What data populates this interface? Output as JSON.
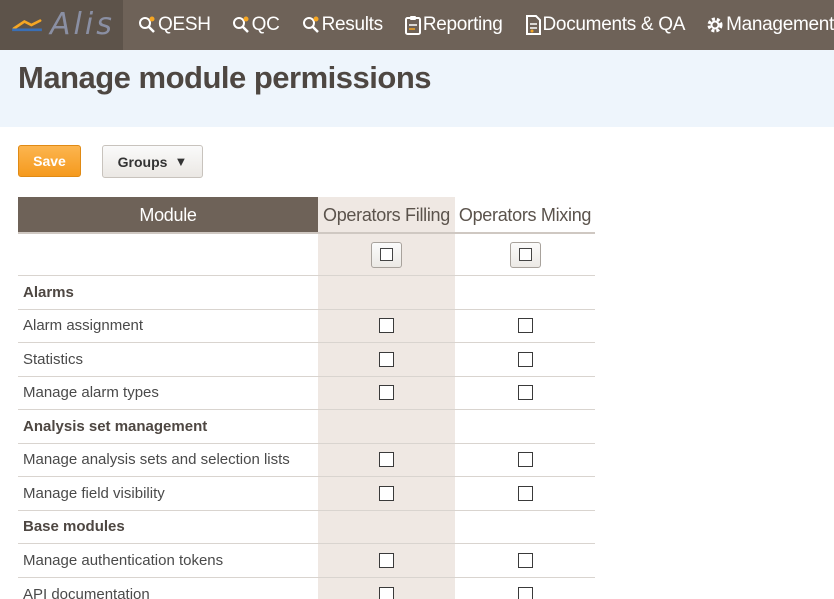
{
  "app": {
    "logo_text": "Alis",
    "nav": [
      {
        "label": "QESH",
        "icon": "search-gear-icon"
      },
      {
        "label": "QC",
        "icon": "search-gear-icon"
      },
      {
        "label": "Results",
        "icon": "search-gear-icon"
      },
      {
        "label": "Reporting",
        "icon": "clipboard-icon"
      },
      {
        "label": "Documents & QA",
        "icon": "document-icon"
      },
      {
        "label": "Management",
        "icon": "gear-icon"
      }
    ]
  },
  "page": {
    "title": "Manage module permissions"
  },
  "toolbar": {
    "save_label": "Save",
    "groups_label": "Groups",
    "groups_caret": "▼"
  },
  "table": {
    "module_header": "Module",
    "groups": [
      "Operators Filling",
      "Operators Mixing"
    ],
    "rows": [
      {
        "type": "section",
        "label": "Alarms"
      },
      {
        "type": "item",
        "label": "Alarm assignment"
      },
      {
        "type": "item",
        "label": "Statistics"
      },
      {
        "type": "item",
        "label": "Manage alarm types"
      },
      {
        "type": "section",
        "label": "Analysis set management"
      },
      {
        "type": "item",
        "label": "Manage analysis sets and selection lists"
      },
      {
        "type": "item",
        "label": "Manage field visibility"
      },
      {
        "type": "section",
        "label": "Base modules"
      },
      {
        "type": "item",
        "label": "Manage authentication tokens"
      },
      {
        "type": "item",
        "label": "API documentation"
      }
    ]
  },
  "colors": {
    "nav_bg": "#6e6258",
    "accent_orange": "#f59a1e",
    "header_band": "#eef5fc",
    "column_shade": "#efe8e3"
  }
}
